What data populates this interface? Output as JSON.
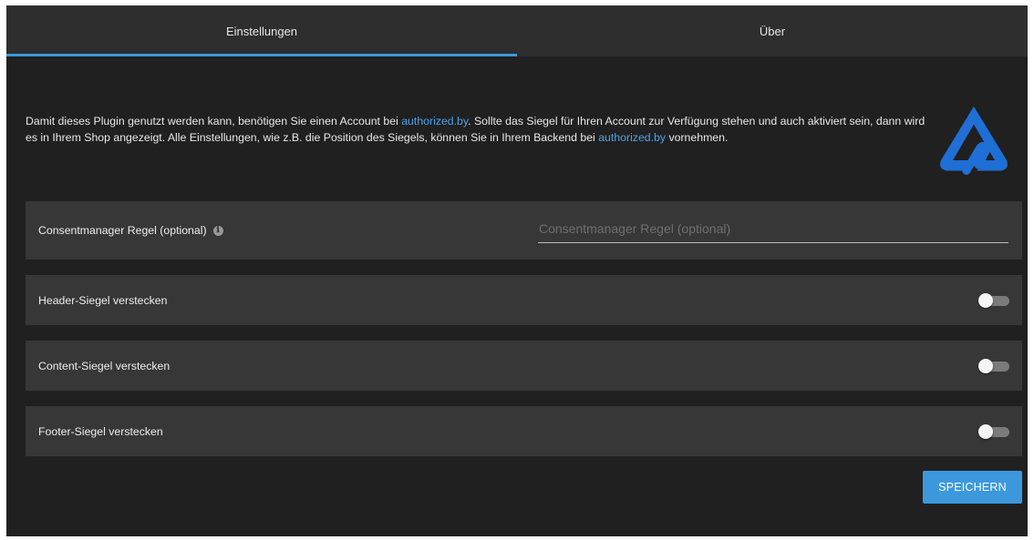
{
  "tabs": [
    {
      "label": "Einstellungen",
      "active": true
    },
    {
      "label": "Über",
      "active": false
    }
  ],
  "intro": {
    "part1": "Damit dieses Plugin genutzt werden kann, benötigen Sie einen Account bei ",
    "link1": "authorized.by",
    "part2": ". Sollte das Siegel für Ihren Account zur Verfügung stehen und auch aktiviert sein, dann wird es in Ihrem Shop angezeigt. Alle Einstellungen, wie z.B. die Position des Siegels, können Sie in Ihrem Backend bei ",
    "link2": "authorized.by",
    "part3": " vornehmen."
  },
  "logo": {
    "icon": "authorized-by-logo",
    "color": "#1f6fd6"
  },
  "consent": {
    "label": "Consentmanager Regel (optional)",
    "info_icon": "ℹ",
    "value": "",
    "placeholder": "Consentmanager Regel (optional)"
  },
  "toggles": [
    {
      "label": "Header-Siegel verstecken",
      "on": false
    },
    {
      "label": "Content-Siegel verstecken",
      "on": false
    },
    {
      "label": "Footer-Siegel verstecken",
      "on": false
    }
  ],
  "save_label": "SPEICHERN",
  "colors": {
    "accent": "#3c98dc",
    "link": "#4aa3e8",
    "background": "#202020",
    "row_background": "#373737"
  }
}
